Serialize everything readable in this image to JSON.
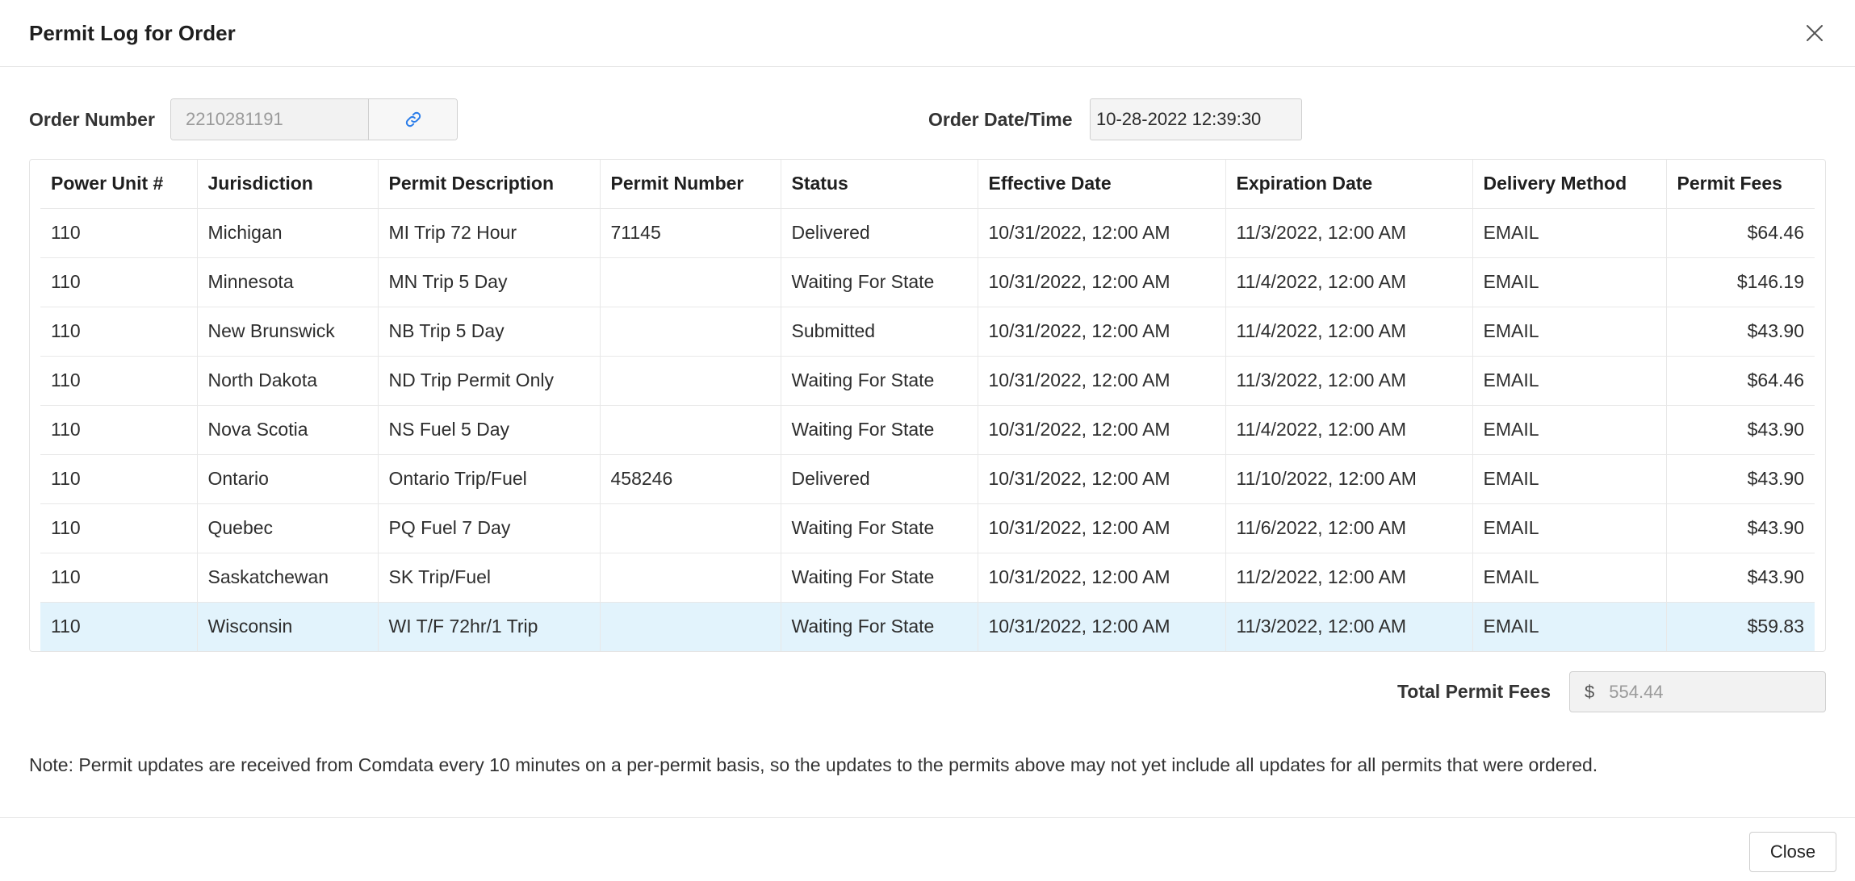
{
  "modal": {
    "title": "Permit Log for Order"
  },
  "order": {
    "number_label": "Order Number",
    "number_value": "2210281191",
    "date_label": "Order Date/Time",
    "date_value": "10-28-2022 12:39:30"
  },
  "table": {
    "columns": [
      "Power Unit #",
      "Jurisdiction",
      "Permit Description",
      "Permit Number",
      "Status",
      "Effective Date",
      "Expiration Date",
      "Delivery Method",
      "Permit Fees"
    ],
    "rows": [
      {
        "unit": "110",
        "jurisdiction": "Michigan",
        "description": "MI Trip 72 Hour",
        "permit_number": "71145",
        "status": "Delivered",
        "effective": "10/31/2022, 12:00 AM",
        "expiration": "11/3/2022, 12:00 AM",
        "delivery": "EMAIL",
        "fees": "$64.46"
      },
      {
        "unit": "110",
        "jurisdiction": "Minnesota",
        "description": "MN Trip 5 Day",
        "permit_number": "",
        "status": "Waiting For State",
        "effective": "10/31/2022, 12:00 AM",
        "expiration": "11/4/2022, 12:00 AM",
        "delivery": "EMAIL",
        "fees": "$146.19"
      },
      {
        "unit": "110",
        "jurisdiction": "New Brunswick",
        "description": "NB Trip 5 Day",
        "permit_number": "",
        "status": "Submitted",
        "effective": "10/31/2022, 12:00 AM",
        "expiration": "11/4/2022, 12:00 AM",
        "delivery": "EMAIL",
        "fees": "$43.90"
      },
      {
        "unit": "110",
        "jurisdiction": "North Dakota",
        "description": "ND Trip Permit Only",
        "permit_number": "",
        "status": "Waiting For State",
        "effective": "10/31/2022, 12:00 AM",
        "expiration": "11/3/2022, 12:00 AM",
        "delivery": "EMAIL",
        "fees": "$64.46"
      },
      {
        "unit": "110",
        "jurisdiction": "Nova Scotia",
        "description": "NS Fuel 5 Day",
        "permit_number": "",
        "status": "Waiting For State",
        "effective": "10/31/2022, 12:00 AM",
        "expiration": "11/4/2022, 12:00 AM",
        "delivery": "EMAIL",
        "fees": "$43.90"
      },
      {
        "unit": "110",
        "jurisdiction": "Ontario",
        "description": "Ontario Trip/Fuel",
        "permit_number": "458246",
        "status": "Delivered",
        "effective": "10/31/2022, 12:00 AM",
        "expiration": "11/10/2022, 12:00 AM",
        "delivery": "EMAIL",
        "fees": "$43.90"
      },
      {
        "unit": "110",
        "jurisdiction": "Quebec",
        "description": "PQ Fuel 7 Day",
        "permit_number": "",
        "status": "Waiting For State",
        "effective": "10/31/2022, 12:00 AM",
        "expiration": "11/6/2022, 12:00 AM",
        "delivery": "EMAIL",
        "fees": "$43.90"
      },
      {
        "unit": "110",
        "jurisdiction": "Saskatchewan",
        "description": "SK Trip/Fuel",
        "permit_number": "",
        "status": "Waiting For State",
        "effective": "10/31/2022, 12:00 AM",
        "expiration": "11/2/2022, 12:00 AM",
        "delivery": "EMAIL",
        "fees": "$43.90"
      },
      {
        "unit": "110",
        "jurisdiction": "Wisconsin",
        "description": "WI T/F 72hr/1 Trip",
        "permit_number": "",
        "status": "Waiting For State",
        "effective": "10/31/2022, 12:00 AM",
        "expiration": "11/3/2022, 12:00 AM",
        "delivery": "EMAIL",
        "fees": "$59.83"
      }
    ],
    "selected_row": 8
  },
  "totals": {
    "label": "Total Permit Fees",
    "currency": "$",
    "value": "554.44"
  },
  "note": "Note: Permit updates are received from Comdata every 10 minutes on a per-permit basis, so the updates to the permits above may not yet include all updates for all permits that were ordered.",
  "footer": {
    "close_label": "Close"
  },
  "icons": {
    "close": "close-icon",
    "link": "link-icon"
  },
  "colors": {
    "selected_row": "#e2f3fc",
    "link_icon": "#2b7de9"
  }
}
